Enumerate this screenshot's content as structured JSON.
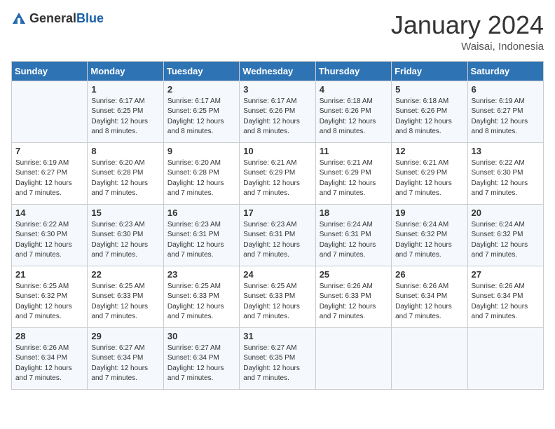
{
  "logo": {
    "text_general": "General",
    "text_blue": "Blue"
  },
  "title": "January 2024",
  "location": "Waisai, Indonesia",
  "days_of_week": [
    "Sunday",
    "Monday",
    "Tuesday",
    "Wednesday",
    "Thursday",
    "Friday",
    "Saturday"
  ],
  "weeks": [
    [
      {
        "day": "",
        "sunrise": "",
        "sunset": "",
        "daylight": ""
      },
      {
        "day": "1",
        "sunrise": "6:17 AM",
        "sunset": "6:25 PM",
        "daylight": "12 hours and 8 minutes."
      },
      {
        "day": "2",
        "sunrise": "6:17 AM",
        "sunset": "6:25 PM",
        "daylight": "12 hours and 8 minutes."
      },
      {
        "day": "3",
        "sunrise": "6:17 AM",
        "sunset": "6:26 PM",
        "daylight": "12 hours and 8 minutes."
      },
      {
        "day": "4",
        "sunrise": "6:18 AM",
        "sunset": "6:26 PM",
        "daylight": "12 hours and 8 minutes."
      },
      {
        "day": "5",
        "sunrise": "6:18 AM",
        "sunset": "6:26 PM",
        "daylight": "12 hours and 8 minutes."
      },
      {
        "day": "6",
        "sunrise": "6:19 AM",
        "sunset": "6:27 PM",
        "daylight": "12 hours and 8 minutes."
      }
    ],
    [
      {
        "day": "7",
        "sunrise": "6:19 AM",
        "sunset": "6:27 PM",
        "daylight": "12 hours and 7 minutes."
      },
      {
        "day": "8",
        "sunrise": "6:20 AM",
        "sunset": "6:28 PM",
        "daylight": "12 hours and 7 minutes."
      },
      {
        "day": "9",
        "sunrise": "6:20 AM",
        "sunset": "6:28 PM",
        "daylight": "12 hours and 7 minutes."
      },
      {
        "day": "10",
        "sunrise": "6:21 AM",
        "sunset": "6:29 PM",
        "daylight": "12 hours and 7 minutes."
      },
      {
        "day": "11",
        "sunrise": "6:21 AM",
        "sunset": "6:29 PM",
        "daylight": "12 hours and 7 minutes."
      },
      {
        "day": "12",
        "sunrise": "6:21 AM",
        "sunset": "6:29 PM",
        "daylight": "12 hours and 7 minutes."
      },
      {
        "day": "13",
        "sunrise": "6:22 AM",
        "sunset": "6:30 PM",
        "daylight": "12 hours and 7 minutes."
      }
    ],
    [
      {
        "day": "14",
        "sunrise": "6:22 AM",
        "sunset": "6:30 PM",
        "daylight": "12 hours and 7 minutes."
      },
      {
        "day": "15",
        "sunrise": "6:23 AM",
        "sunset": "6:30 PM",
        "daylight": "12 hours and 7 minutes."
      },
      {
        "day": "16",
        "sunrise": "6:23 AM",
        "sunset": "6:31 PM",
        "daylight": "12 hours and 7 minutes."
      },
      {
        "day": "17",
        "sunrise": "6:23 AM",
        "sunset": "6:31 PM",
        "daylight": "12 hours and 7 minutes."
      },
      {
        "day": "18",
        "sunrise": "6:24 AM",
        "sunset": "6:31 PM",
        "daylight": "12 hours and 7 minutes."
      },
      {
        "day": "19",
        "sunrise": "6:24 AM",
        "sunset": "6:32 PM",
        "daylight": "12 hours and 7 minutes."
      },
      {
        "day": "20",
        "sunrise": "6:24 AM",
        "sunset": "6:32 PM",
        "daylight": "12 hours and 7 minutes."
      }
    ],
    [
      {
        "day": "21",
        "sunrise": "6:25 AM",
        "sunset": "6:32 PM",
        "daylight": "12 hours and 7 minutes."
      },
      {
        "day": "22",
        "sunrise": "6:25 AM",
        "sunset": "6:33 PM",
        "daylight": "12 hours and 7 minutes."
      },
      {
        "day": "23",
        "sunrise": "6:25 AM",
        "sunset": "6:33 PM",
        "daylight": "12 hours and 7 minutes."
      },
      {
        "day": "24",
        "sunrise": "6:25 AM",
        "sunset": "6:33 PM",
        "daylight": "12 hours and 7 minutes."
      },
      {
        "day": "25",
        "sunrise": "6:26 AM",
        "sunset": "6:33 PM",
        "daylight": "12 hours and 7 minutes."
      },
      {
        "day": "26",
        "sunrise": "6:26 AM",
        "sunset": "6:34 PM",
        "daylight": "12 hours and 7 minutes."
      },
      {
        "day": "27",
        "sunrise": "6:26 AM",
        "sunset": "6:34 PM",
        "daylight": "12 hours and 7 minutes."
      }
    ],
    [
      {
        "day": "28",
        "sunrise": "6:26 AM",
        "sunset": "6:34 PM",
        "daylight": "12 hours and 7 minutes."
      },
      {
        "day": "29",
        "sunrise": "6:27 AM",
        "sunset": "6:34 PM",
        "daylight": "12 hours and 7 minutes."
      },
      {
        "day": "30",
        "sunrise": "6:27 AM",
        "sunset": "6:34 PM",
        "daylight": "12 hours and 7 minutes."
      },
      {
        "day": "31",
        "sunrise": "6:27 AM",
        "sunset": "6:35 PM",
        "daylight": "12 hours and 7 minutes."
      },
      {
        "day": "",
        "sunrise": "",
        "sunset": "",
        "daylight": ""
      },
      {
        "day": "",
        "sunrise": "",
        "sunset": "",
        "daylight": ""
      },
      {
        "day": "",
        "sunrise": "",
        "sunset": "",
        "daylight": ""
      }
    ]
  ]
}
